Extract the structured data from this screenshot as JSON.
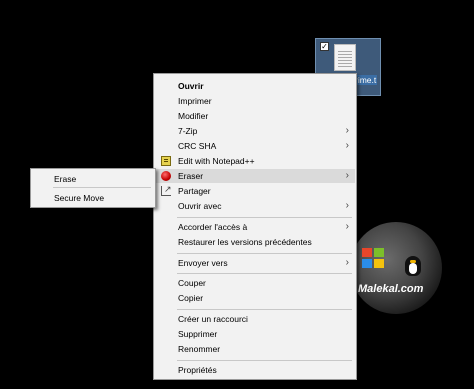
{
  "desktop": {
    "file_label": "rime.t",
    "logo_text": "Malekal.com"
  },
  "context_menu": {
    "items": [
      {
        "label": "Ouvrir"
      },
      {
        "label": "Imprimer"
      },
      {
        "label": "Modifier"
      },
      {
        "label": "7-Zip"
      },
      {
        "label": "CRC SHA"
      },
      {
        "label": "Edit with Notepad++"
      },
      {
        "label": "Eraser"
      },
      {
        "label": "Partager"
      },
      {
        "label": "Ouvrir avec"
      },
      {
        "label": "Accorder l'accès à"
      },
      {
        "label": "Restaurer les versions précédentes"
      },
      {
        "label": "Envoyer vers"
      },
      {
        "label": "Couper"
      },
      {
        "label": "Copier"
      },
      {
        "label": "Créer un raccourci"
      },
      {
        "label": "Supprimer"
      },
      {
        "label": "Renommer"
      },
      {
        "label": "Propriétés"
      }
    ],
    "highlighted_item": "Eraser",
    "submenu_arrow_glyph": "›"
  },
  "eraser_submenu": {
    "items": [
      {
        "label": "Erase"
      },
      {
        "label": "Secure Move"
      }
    ]
  },
  "colors": {
    "desktop_bg": "#000000",
    "menu_bg": "#f2f2f2",
    "highlight_bg": "#dadada",
    "file_selection": "#3e5a7a"
  }
}
